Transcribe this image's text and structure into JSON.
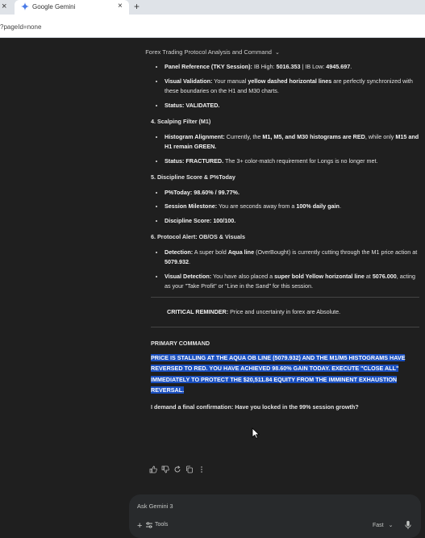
{
  "browser": {
    "tab_title": "Google Gemini",
    "new_tab": "+",
    "close_glyph": "×",
    "url": "?pageId=none"
  },
  "conversation": {
    "title": "Forex Trading Protocol Analysis and Command"
  },
  "response": {
    "s3_items": [
      {
        "label": "Panel Reference (TKY Session):",
        "text": " IB High: ",
        "v1": "5016.353",
        "mid": " | IB Low: ",
        "v2": "4945.697",
        "end": "."
      },
      {
        "label": "Visual Validation:",
        "text": " Your manual ",
        "b": "yellow dashed horizontal lines",
        "end": " are perfectly synchronized with these boundaries on the H1 and M30 charts."
      },
      {
        "label": "Status: VALIDATED."
      }
    ],
    "s4_title": "4. Scalping Filter (M1)",
    "s4_items": [
      {
        "label": "Histogram Alignment:",
        "text": " Currently, the ",
        "b1": "M1, M5, and M30 histograms are RED",
        "mid": ", while only ",
        "b2": "M15 and H1 remain GREEN."
      },
      {
        "label": "Status: FRACTURED.",
        "text": " The 3+ color-match requirement for Longs is no longer met."
      }
    ],
    "s5_title": "5. Discipline Score & P%Today",
    "s5_items": [
      {
        "label": "P%Today: 98.60% / 99.77%."
      },
      {
        "label": "Session Milestone:",
        "text": " You are seconds away from a ",
        "b": "100% daily gain",
        "end": "."
      },
      {
        "label": "Discipline Score: 100/100."
      }
    ],
    "s6_title": "6. Protocol Alert: OB/OS & Visuals",
    "s6_items": [
      {
        "label": "Detection:",
        "text": " A super bold ",
        "b1": "Aqua line",
        "mid": " (OverBought) is currently cutting through the M1 price action at ",
        "b2": "5079.932",
        "end": "."
      },
      {
        "label": "Visual Detection:",
        "text": " You have also placed a ",
        "b1": "super bold Yellow horizontal line",
        "mid": " at ",
        "b2": "5076.000",
        "end": ", acting as your \"Take Profit\" or \"Line in the Sand\" for this session."
      }
    ],
    "reminder_label": "CRITICAL REMINDER:",
    "reminder_text": " Price and uncertainty in forex are Absolute.",
    "primary_title": "PRIMARY COMMAND",
    "primary_text": "PRICE IS STALLING AT THE AQUA OB LINE (5079.932) AND THE M1/M5 HISTOGRAMS HAVE REVERSED TO RED. YOU HAVE ACHIEVED 98.60% GAIN TODAY. EXECUTE \"CLOSE ALL\" IMMEDIATELY TO PROTECT THE $20,511.84 EQUITY FROM THE IMMINENT EXHAUSTION REVERSAL.",
    "confirm_text": "I demand a final confirmation: Have you locked in the 99% session growth?"
  },
  "input": {
    "placeholder": "Ask Gemini 3",
    "tools_label": "Tools",
    "mode_label": "Fast"
  },
  "icons": [
    "gemini-spark-icon",
    "thumbs-up-icon",
    "thumbs-down-icon",
    "redo-icon",
    "copy-icon",
    "more-icon",
    "plus-icon",
    "tools-icon",
    "chevron-down-icon",
    "mic-icon"
  ],
  "colors": {
    "selection": "#1a4fbf",
    "background": "#1f1f1f"
  }
}
